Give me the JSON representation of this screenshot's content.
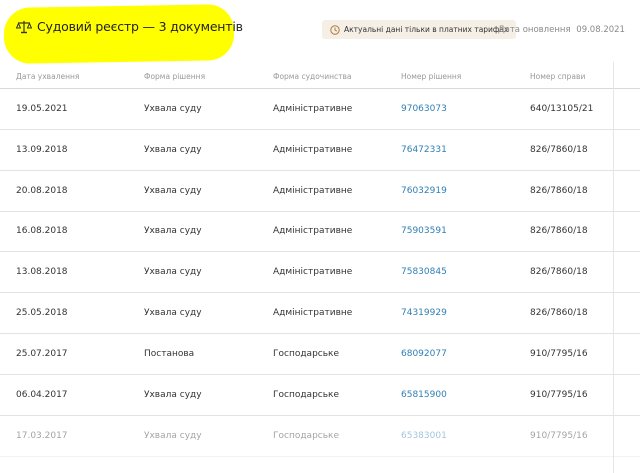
{
  "header": {
    "title": "Судовий реєстр — 3 документів",
    "badge": "Актуальні дані тільки в платних тарифах",
    "update_label": "Дата оновлення",
    "update_date": "09.08.2021"
  },
  "table": {
    "columns": [
      "Дата ухвалення",
      "Форма рішення",
      "Форма судочинства",
      "Номер рішення",
      "Номер справи"
    ],
    "rows": [
      {
        "date": "19.05.2021",
        "form": "Ухвала суду",
        "proc": "Адміністративне",
        "num": "97063073",
        "case": "640/13105/21"
      },
      {
        "date": "13.09.2018",
        "form": "Ухвала суду",
        "proc": "Адміністративне",
        "num": "76472331",
        "case": "826/7860/18"
      },
      {
        "date": "20.08.2018",
        "form": "Ухвала суду",
        "proc": "Адміністративне",
        "num": "76032919",
        "case": "826/7860/18"
      },
      {
        "date": "16.08.2018",
        "form": "Ухвала суду",
        "proc": "Адміністративне",
        "num": "75903591",
        "case": "826/7860/18"
      },
      {
        "date": "13.08.2018",
        "form": "Ухвала суду",
        "proc": "Адміністративне",
        "num": "75830845",
        "case": "826/7860/18"
      },
      {
        "date": "25.05.2018",
        "form": "Ухвала суду",
        "proc": "Адміністративне",
        "num": "74319929",
        "case": "826/7860/18"
      },
      {
        "date": "25.07.2017",
        "form": "Постанова",
        "proc": "Господарське",
        "num": "68092077",
        "case": "910/7795/16"
      },
      {
        "date": "06.04.2017",
        "form": "Ухвала суду",
        "proc": "Господарське",
        "num": "65815900",
        "case": "910/7795/16"
      },
      {
        "date": "17.03.2017",
        "form": "Ухвала суду",
        "proc": "Господарське",
        "num": "65383001",
        "case": "910/7795/16"
      }
    ]
  },
  "colors": {
    "link": "#2f7fb5",
    "highlight": "#ffff00",
    "badge_bg": "#f6efe6"
  },
  "icons": {
    "title": "scales-icon",
    "badge": "clock-icon"
  }
}
